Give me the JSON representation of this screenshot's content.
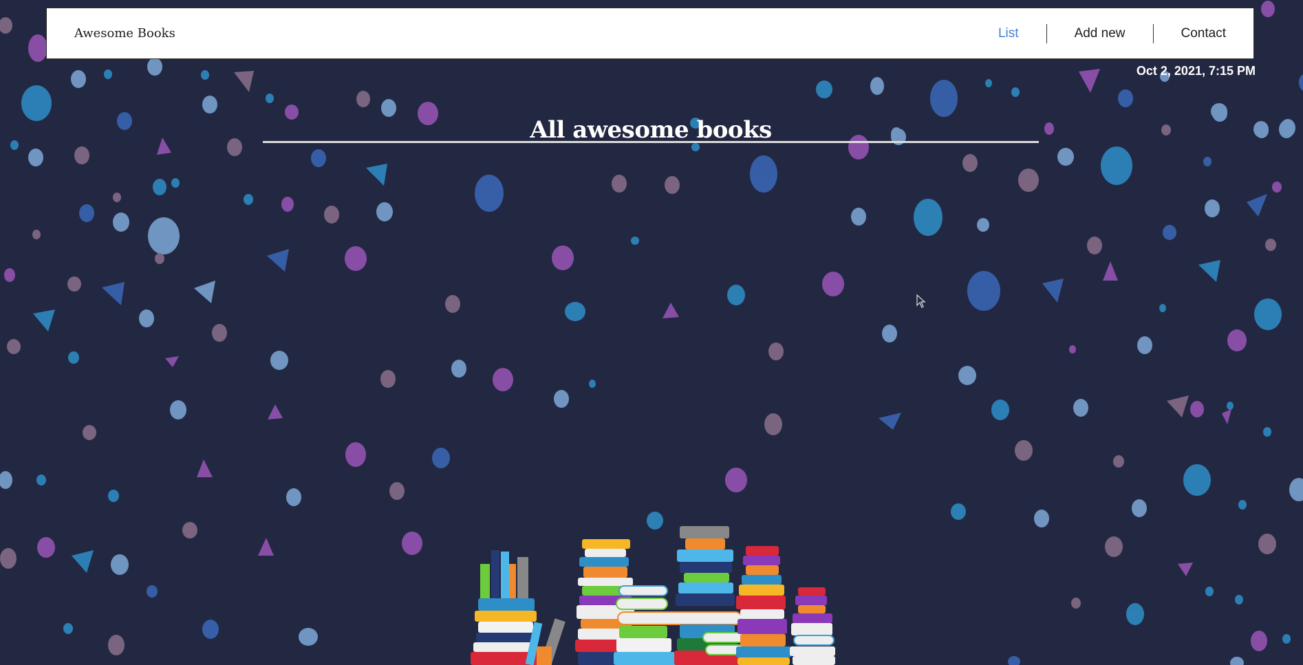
{
  "navbar": {
    "brand": "Awesome Books",
    "links": [
      {
        "label": "List",
        "active": true
      },
      {
        "label": "Add new",
        "active": false
      },
      {
        "label": "Contact",
        "active": false
      }
    ]
  },
  "datetime": "Oct 2, 2021, 7:15 PM",
  "main": {
    "title": "All awesome books"
  },
  "colors": {
    "background": "#232842",
    "active_link": "#3f7fd9",
    "navbar_bg": "#ffffff",
    "title": "#ffffff"
  },
  "icons": [
    "mouse-cursor-icon",
    "book-stack-illustration",
    "confetti-background"
  ]
}
